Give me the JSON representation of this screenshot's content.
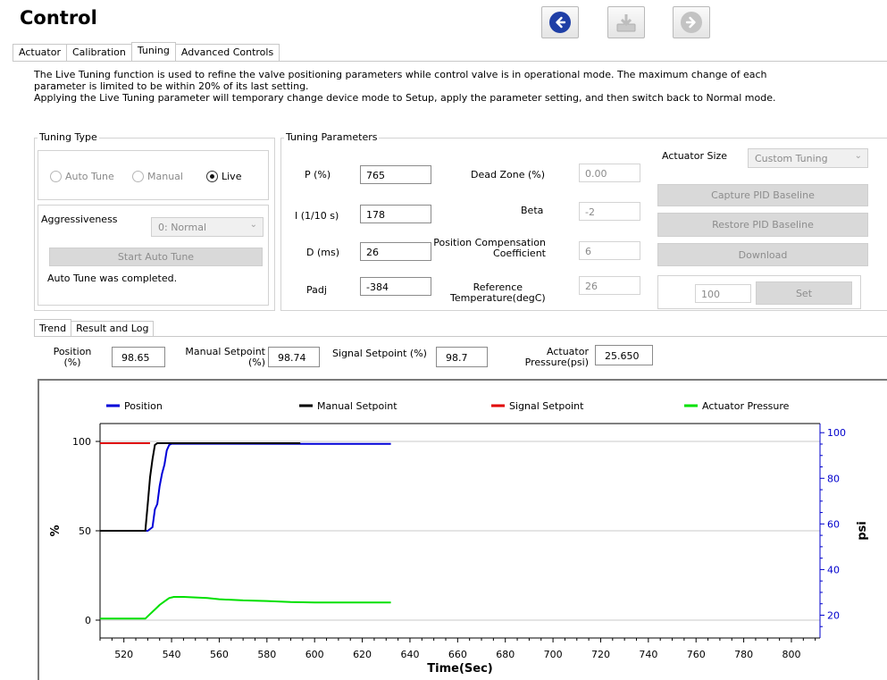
{
  "header": {
    "title": "Control"
  },
  "nav": {
    "back_icon": "back-arrow-icon",
    "download_icon": "download-icon",
    "forward_icon": "forward-arrow-icon",
    "back_color": "#1f3fa6"
  },
  "tabs": [
    {
      "label": "Actuator"
    },
    {
      "label": "Calibration"
    },
    {
      "label": "Tuning",
      "active": true
    },
    {
      "label": "Advanced Controls"
    }
  ],
  "description": {
    "line1": "The Live Tuning function is used to refine the valve positioning parameters while control valve is in operational mode. The maximum change of each",
    "line2": "parameter is limited to be within 20% of its last setting.",
    "line3": "Applying the  Live Tuning parameter will temporary change device mode to Setup, apply the parameter setting, and then switch back to Normal mode."
  },
  "tuning_type": {
    "group_label": "Tuning Type",
    "options": [
      "Auto Tune",
      "Manual",
      "Live"
    ],
    "selected": "Live",
    "aggressiveness_label": "Aggressiveness",
    "aggressiveness_value": "0: Normal",
    "start_button": "Start Auto Tune",
    "status": "Auto Tune was completed."
  },
  "tuning_params": {
    "group_label": "Tuning Parameters",
    "p_label": "P (%)",
    "p_value": "765",
    "i_label": "I (1/10 s)",
    "i_value": "178",
    "d_label": "D (ms)",
    "d_value": "26",
    "padj_label": "Padj",
    "padj_value": "-384",
    "deadzone_label": "Dead Zone (%)",
    "deadzone_value": "0.00",
    "beta_label": "Beta",
    "beta_value": "-2",
    "poscomp_label1": "Position Compensation",
    "poscomp_label2": "Coefficient",
    "poscomp_value": "6",
    "reftemp_label1": "Reference",
    "reftemp_label2": "Temperature(degC)",
    "reftemp_value": "26"
  },
  "actuator": {
    "size_label": "Actuator Size",
    "size_value": "Custom Tuning",
    "capture_button": "Capture PID Baseline",
    "restore_button": "Restore PID Baseline",
    "download_button": "Download",
    "set_value": "100",
    "set_button": "Set"
  },
  "subtabs": [
    {
      "label": "Trend",
      "active": true
    },
    {
      "label": "Result and Log"
    }
  ],
  "readouts": {
    "position_label1": "Position",
    "position_label2": "(%)",
    "position_value": "98.65",
    "manual_label1": "Manual Setpoint",
    "manual_label2": "(%)",
    "manual_value": "98.74",
    "signal_label": "Signal Setpoint (%)",
    "signal_value": "98.7",
    "pressure_label1": "Actuator",
    "pressure_label2": "Pressure(psi)",
    "pressure_value": "25.650"
  },
  "chart_data": {
    "type": "line",
    "xlabel": "Time(Sec)",
    "ylabel_left": "%",
    "ylabel_right": "psi",
    "xlim": [
      510,
      812
    ],
    "ylim_left": [
      -10,
      110
    ],
    "ylim_right": [
      10,
      104
    ],
    "x_ticks": [
      520,
      540,
      560,
      580,
      600,
      620,
      640,
      660,
      680,
      700,
      720,
      740,
      760,
      780,
      800
    ],
    "y_left_ticks": [
      0,
      50,
      100
    ],
    "y_right_ticks": [
      20,
      40,
      60,
      80,
      100
    ],
    "grid": true,
    "legend_position": "top",
    "series": [
      {
        "name": "Position",
        "color": "#0000d8",
        "axis": "left",
        "x": [
          510,
          530,
          532,
          533,
          534,
          535,
          536,
          537,
          538,
          539,
          540,
          560,
          600,
          632
        ],
        "y": [
          50,
          50,
          52,
          62,
          65,
          75,
          82,
          87,
          95,
          98,
          98.7,
          98.7,
          98.65,
          98.65
        ]
      },
      {
        "name": "Manual Setpoint",
        "color": "#000000",
        "axis": "left",
        "x": [
          510,
          529,
          530,
          531,
          532,
          533,
          534,
          540,
          594
        ],
        "y": [
          50,
          50,
          65,
          80,
          90,
          98,
          99,
          99,
          99
        ]
      },
      {
        "name": "Signal Setpoint",
        "color": "#e00000",
        "axis": "left",
        "x": [
          510,
          531
        ],
        "y": [
          99,
          99
        ]
      },
      {
        "name": "Actuator Pressure",
        "color": "#00e000",
        "axis": "right",
        "x": [
          510,
          529,
          531,
          533,
          535,
          537,
          539,
          541,
          545,
          550,
          555,
          560,
          570,
          580,
          590,
          600,
          610,
          620,
          632
        ],
        "y": [
          18.5,
          18.5,
          20.5,
          22.5,
          24.5,
          26,
          27.5,
          28,
          28,
          27.8,
          27.5,
          27,
          26.5,
          26.2,
          25.8,
          25.6,
          25.6,
          25.6,
          25.6
        ]
      }
    ]
  }
}
